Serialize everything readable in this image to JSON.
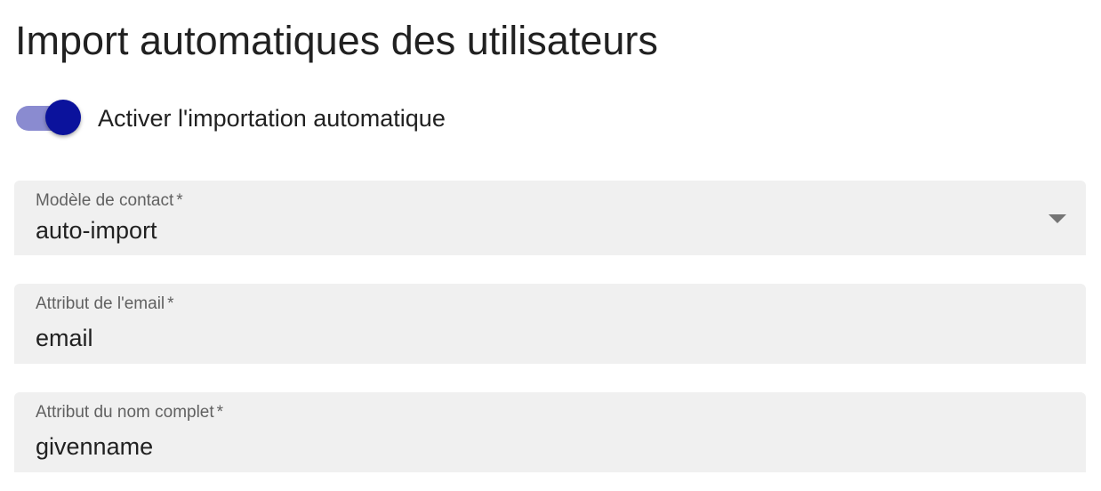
{
  "page": {
    "title": "Import automatiques des utilisateurs"
  },
  "auto_import_toggle": {
    "label": "Activer l'importation automatique",
    "checked": true,
    "track_color": "#8a8bd0",
    "thumb_color": "#0b129c"
  },
  "form": {
    "contact_model": {
      "label": "Modèle de contact",
      "required_marker": "*",
      "value": "auto-import",
      "icon": "chevron-down-icon"
    },
    "email_attribute": {
      "label": "Attribut de l'email",
      "required_marker": "*",
      "value": "email"
    },
    "fullname_attribute": {
      "label": "Attribut du nom complet",
      "required_marker": "*",
      "value": "givenname"
    }
  },
  "colors": {
    "field_background": "#f0f0f0",
    "label_text": "#616161",
    "value_text": "#212121"
  }
}
